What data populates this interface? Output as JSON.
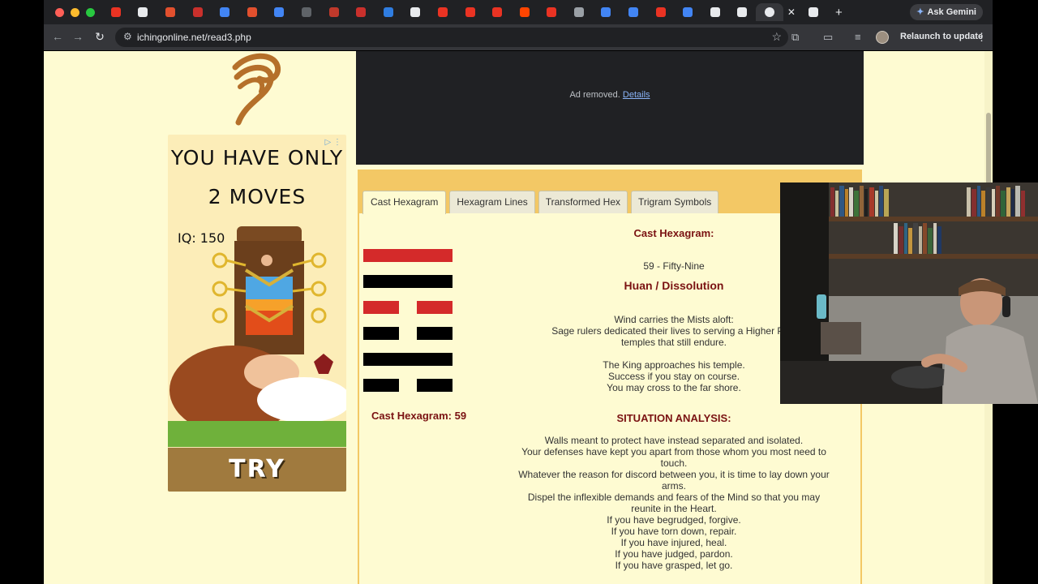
{
  "browser": {
    "address_bar": {
      "url": "ichingonline.net/read3.php"
    },
    "ask_gemini_label": "Ask Gemini",
    "relaunch_label": "Relaunch to update",
    "tab_favicon_colors": [
      "#ea3323",
      "#e8eaed",
      "#e2502e",
      "#c9302c",
      "#4285f4",
      "#e2502e",
      "#4285f4",
      "#5f6368",
      "#c0392b",
      "#c9302c",
      "#2f7de1",
      "#e8eaed",
      "#ea3323",
      "#ea3323",
      "#ea3323",
      "#ff4500",
      "#ea3323",
      "#9aa0a6",
      "#4285f4",
      "#4285f4",
      "#ea3323",
      "#4285f4",
      "#e8eaed",
      "#e8eaed",
      "#e8eaed",
      "#e8eaed"
    ]
  },
  "page": {
    "top_ad": {
      "removed_text": "Ad removed.",
      "details_link": "Details"
    },
    "left_ad": {
      "headline_line1": "YOU HAVE ONLY",
      "headline_line2": "2 MOVES",
      "iq_label": "IQ: 150",
      "cta": "TRY"
    },
    "tabs": [
      {
        "label": "Cast Hexagram",
        "active": true
      },
      {
        "label": "Hexagram Lines",
        "active": false
      },
      {
        "label": "Transformed Hex",
        "active": false
      },
      {
        "label": "Trigram Symbols",
        "active": false
      }
    ],
    "hexagram": {
      "lines": [
        {
          "type": "solid",
          "color": "red"
        },
        {
          "type": "solid",
          "color": "black"
        },
        {
          "type": "broken",
          "color": "red"
        },
        {
          "type": "broken",
          "color": "black"
        },
        {
          "type": "solid",
          "color": "black"
        },
        {
          "type": "broken",
          "color": "black"
        }
      ],
      "caption": "Cast Hexagram: 59"
    },
    "reading": {
      "section_title": "Cast Hexagram:",
      "number_text": "59 - Fifty-Nine",
      "name": "Huan / Dissolution",
      "verse1": [
        "Wind carries the Mists aloft:",
        "Sage rulers dedicated their lives to serving a Higher Pow",
        "temples that still endure."
      ],
      "verse2": [
        "The King approaches his temple.",
        "Success if you stay on course.",
        "You may cross to the far shore."
      ],
      "analysis_title": "SITUATION ANALYSIS:",
      "analysis": [
        "Walls meant to protect have instead separated and isolated.",
        "Your defenses have kept you apart from those whom you most need to",
        "touch.",
        "Whatever the reason for discord between you, it is time to lay down your",
        "arms.",
        "Dispel the inflexible demands and fears of the Mind so that you may",
        "reunite in the Heart.",
        "If you have begrudged, forgive.",
        "If you have torn down, repair.",
        "If you have injured, heal.",
        "If you have judged, pardon.",
        "If you have grasped, let go."
      ]
    }
  }
}
